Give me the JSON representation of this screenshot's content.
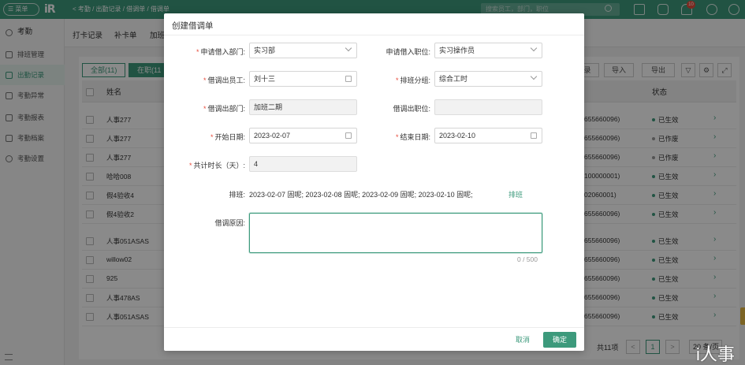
{
  "topbar": {
    "menu_label": "☰ 菜单",
    "logo": "iR",
    "breadcrumb": "<  考勤 / 出勤记录 / 借调单 / 借调单",
    "search_placeholder": "搜索员工，部门，职位",
    "notification_count": "10"
  },
  "sidebar": {
    "header": "考勤",
    "items": [
      {
        "label": "排班管理"
      },
      {
        "label": "出勤记录"
      },
      {
        "label": "考勤异常"
      },
      {
        "label": "考勤报表"
      },
      {
        "label": "考勤档案"
      },
      {
        "label": "考勤设置"
      }
    ]
  },
  "subnav": [
    "打卡记录",
    "补卡单",
    "加班"
  ],
  "filters": {
    "all": "全部(11)",
    "active": "在职(11"
  },
  "toolbar": {
    "export_partial": "录",
    "import": "导入",
    "export": "导出"
  },
  "table": {
    "col_name": "姓名",
    "col_status": "状态",
    "rows": [
      {
        "name": "人事277",
        "id": "655660096)",
        "status": "已生效",
        "status_color": "#3d9a7c"
      },
      {
        "name": "人事277",
        "id": "655660096)",
        "status": "已作废",
        "status_color": "#999999"
      },
      {
        "name": "人事277",
        "id": "655660096)",
        "status": "已作废",
        "status_color": "#999999"
      },
      {
        "name": "哈哈008",
        "id": "100000001)",
        "status": "已生效",
        "status_color": "#3d9a7c"
      },
      {
        "name": "假4验收4",
        "id": "02060001)",
        "status": "已生效",
        "status_color": "#3d9a7c"
      },
      {
        "name": "假4验收2",
        "id": "655660096)",
        "status": "已生效",
        "status_color": "#3d9a7c"
      },
      {
        "name": "人事051ASAS",
        "id": "655660096)",
        "status": "已生效",
        "status_color": "#3d9a7c"
      },
      {
        "name": "willow02",
        "id": "655660096)",
        "status": "已生效",
        "status_color": "#3d9a7c"
      },
      {
        "name": "925",
        "id": "655660096)",
        "status": "已生效",
        "status_color": "#3d9a7c"
      },
      {
        "name": "人事478AS",
        "id": "655660096)",
        "status": "已生效",
        "status_color": "#3d9a7c"
      },
      {
        "name": "人事051ASAS",
        "id": "655660096)",
        "status": "已生效",
        "status_color": "#3d9a7c"
      }
    ]
  },
  "pager": {
    "total": "共11项",
    "current": "1",
    "size": "20 条/页",
    "prev": "<",
    "next": ">"
  },
  "watermark": "i人事",
  "modal": {
    "title": "创建借调单",
    "fields": {
      "borrow_in_dept": {
        "label": "申请借入部门:",
        "value": "实习部"
      },
      "borrow_in_position": {
        "label": "申请借入职位:",
        "value": "实习操作员"
      },
      "borrowed_employee": {
        "label": "借调出员工:",
        "value": "刘十三"
      },
      "shift_group": {
        "label": "排班分组:",
        "value": "综合工时"
      },
      "borrow_out_dept": {
        "label": "借调出部门:",
        "value": "加班二期"
      },
      "borrow_out_position": {
        "label": "借调出职位:",
        "value": ""
      },
      "start_date": {
        "label": "开始日期:",
        "value": "2023-02-07"
      },
      "end_date": {
        "label": "结束日期:",
        "value": "2023-02-10"
      },
      "duration": {
        "label": "共计时长（天）:",
        "value": "4"
      }
    },
    "schedule_label": "排班:",
    "schedule_text": "2023-02-07 固呢; 2023-02-08 固呢; 2023-02-09 固呢; 2023-02-10 固呢;",
    "schedule_link": "排班",
    "reason_label": "借调原因:",
    "reason_value": "",
    "char_count": "0 / 500",
    "cancel": "取消",
    "confirm": "确定"
  },
  "colors": {
    "primary": "#3d9a7c",
    "required": "#e74c3c",
    "mask": "rgba(0,0,0,0.46)"
  }
}
